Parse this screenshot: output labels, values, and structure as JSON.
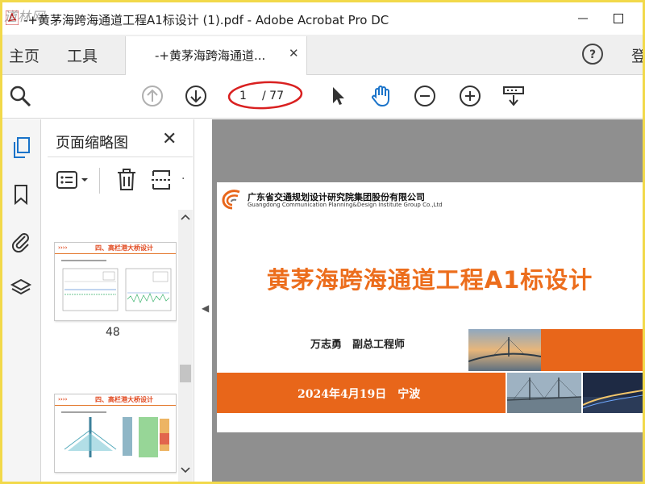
{
  "window": {
    "title": "-+黄茅海跨海通道工程A1标设计 (1).pdf - Adobe Acrobat Pro DC",
    "watermark": "道林网"
  },
  "menu": {
    "home": "主页",
    "tools": "工具",
    "doc_tab": "-+黄茅海跨海通道...",
    "signin": "登"
  },
  "toolbar": {
    "page_current": "1",
    "page_total": "/ 77"
  },
  "panel": {
    "title": "页面缩略图",
    "thumbnails": [
      {
        "heading": "四、高栏港大桥设计",
        "number": "48"
      },
      {
        "heading": "四、高栏港大桥设计",
        "number": ""
      }
    ]
  },
  "document": {
    "company_cn": "广东省交通规划设计研究院集团股份有限公司",
    "company_en": "Guangdong Communication Planning&Design Institute Group Co.,Ltd",
    "title": "黄茅海跨海通道工程A1标设计",
    "author": "万志勇　副总工程师",
    "date_place": "2024年4月19日　宁波"
  },
  "colors": {
    "accent_orange": "#e8661a",
    "title_orange": "#ec6d1c",
    "highlight_ellipse": "#d92020",
    "frame_yellow": "#f2d94a"
  }
}
